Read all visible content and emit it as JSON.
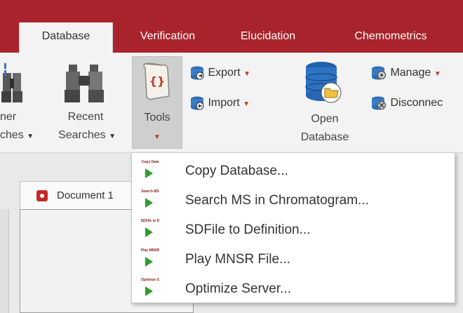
{
  "tabs": [
    {
      "label": "Database",
      "active": true
    },
    {
      "label": "Verification",
      "active": false
    },
    {
      "label": "Elucidation",
      "active": false
    },
    {
      "label": "Chemometrics",
      "active": false
    }
  ],
  "ribbon": {
    "partial_searches": {
      "line1": "ner",
      "line2": "ches"
    },
    "recent_searches": {
      "line1": "Recent",
      "line2": "Searches"
    },
    "tools": {
      "label": "Tools"
    },
    "export": {
      "label": "Export"
    },
    "import": {
      "label": "Import"
    },
    "open_database": {
      "line1": "Open",
      "line2": "Database"
    },
    "manage": {
      "label": "Manage"
    },
    "disconnect": {
      "label": "Disconnec"
    }
  },
  "document_tab": {
    "label": "Document 1"
  },
  "tools_menu": {
    "items": [
      {
        "icon_caption": "Copy Data",
        "label": "Copy Database..."
      },
      {
        "icon_caption": "Search MS",
        "label": "Search MS in Chromatogram..."
      },
      {
        "icon_caption": "SDFile to D",
        "label": "SDFile to Definition..."
      },
      {
        "icon_caption": "Play MNSR",
        "label": "Play MNSR File..."
      },
      {
        "icon_caption": "Optimize S",
        "label": "Optimize Server..."
      }
    ]
  },
  "colors": {
    "tab_bar": "#a8232b",
    "ribbon_bg": "#f3f3f3",
    "play_icon": "#2e9e2e"
  }
}
